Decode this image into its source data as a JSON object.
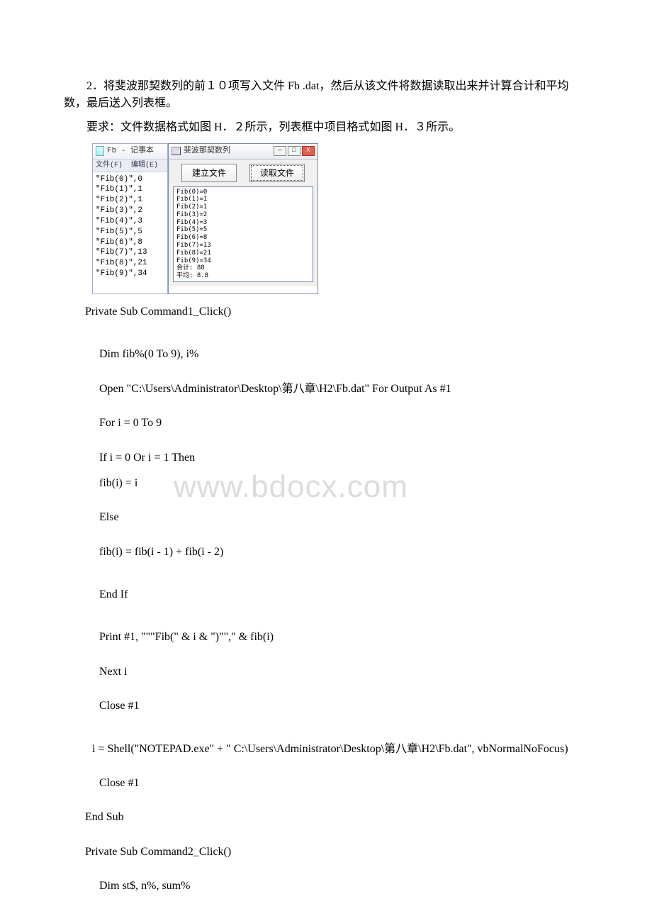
{
  "question": {
    "line1": "2．将斐波那契数列的前１０项写入文件 Fb .dat，然后从该文件将数据读取出来并计算合计和平均数，最后送入列表框。",
    "line2": "要求：文件数据格式如图 H．２所示，列表框中项目格式如图 H．３所示。"
  },
  "notepad": {
    "title": "Fb - 记事本",
    "menu_file": "文件(F)",
    "menu_edit": "编辑(E)",
    "content": "\"Fib(0)\",0\n\"Fib(1)\",1\n\"Fib(2)\",1\n\"Fib(3)\",2\n\"Fib(4)\",3\n\"Fib(5)\",5\n\"Fib(6)\",8\n\"Fib(7)\",13\n\"Fib(8)\",21\n\"Fib(9)\",34"
  },
  "vb": {
    "title": "斐波那契数列",
    "btn1": "建立文件",
    "btn2": "读取文件",
    "list": "Fib(0)=0\nFib(1)=1\nFib(2)=1\nFib(3)=2\nFib(4)=3\nFib(5)=5\nFib(6)=8\nFib(7)=13\nFib(8)=21\nFib(9)=34\n合计: 88\n平均: 8.8",
    "min": "—",
    "max": "□",
    "close": "X"
  },
  "code": {
    "l0": "Private Sub Command1_Click()",
    "l1": "Dim fib%(0 To 9), i%",
    "l2": "Open \"C:\\Users\\Administrator\\Desktop\\第八章\\H2\\Fb.dat\" For Output As #1",
    "l3": "For i = 0 To 9",
    "l4": "If i = 0 Or i = 1 Then",
    "l5": "fib(i) = i",
    "l6": "Else",
    "l7": "fib(i) = fib(i - 1) + fib(i - 2)",
    "l8": "End If",
    "l9": "Print #1, \"\"\"Fib(\" & i & \")\"\",\" & fib(i)",
    "l10": "Next i",
    "l11": "Close #1",
    "l12": "i = Shell(\"NOTEPAD.exe\" + \" C:\\Users\\Administrator\\Desktop\\第八章\\H2\\Fb.dat\", vbNormalNoFocus)",
    "l13": " Close #1",
    "l14": "End Sub",
    "l15": "Private Sub Command2_Click()",
    "l16": " Dim st$, n%, sum%"
  },
  "watermark": "www.bdocx.com"
}
